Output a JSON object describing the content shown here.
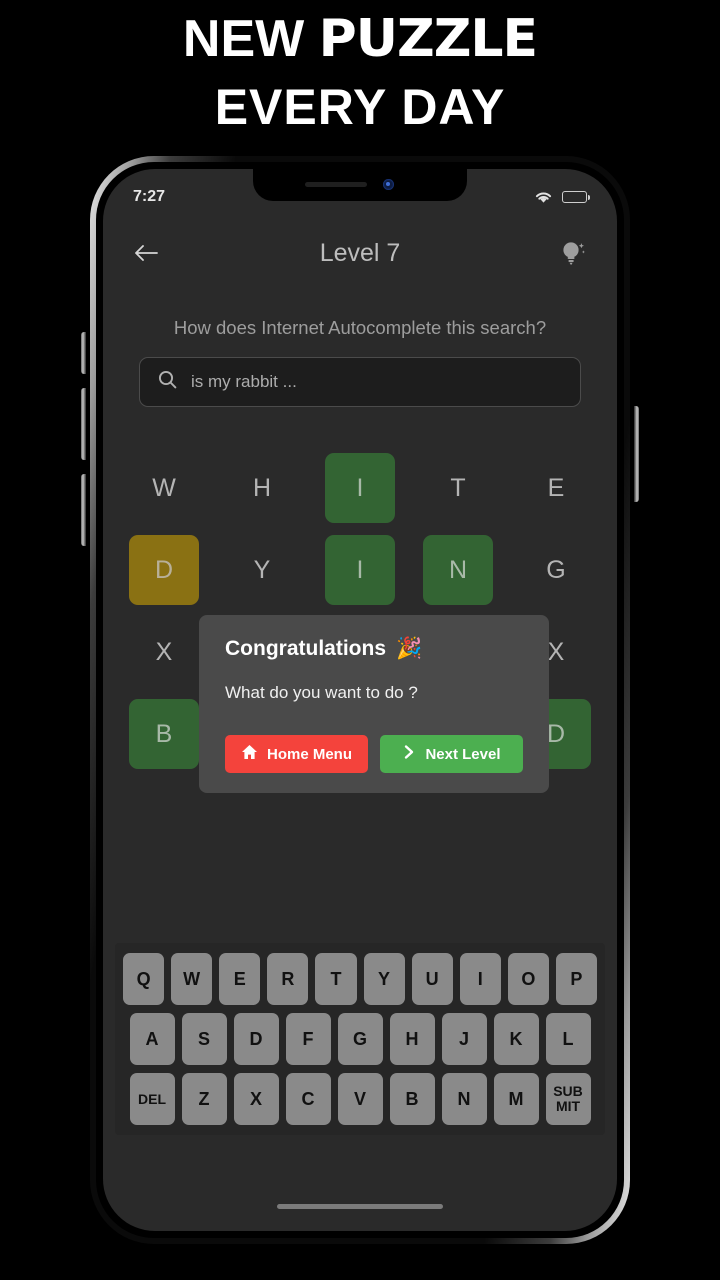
{
  "promo": {
    "line1_a": "NEW ",
    "line1_b": "PUZZLE",
    "line2": "EVERY DAY"
  },
  "status_bar": {
    "time": "7:27",
    "wifi_icon": "wifi-icon",
    "battery_icon": "battery-full-icon"
  },
  "app_header": {
    "back_icon": "back-arrow-icon",
    "title": "Level 7",
    "hint_icon": "lightbulb-hint-icon"
  },
  "puzzle": {
    "question": "How does Internet Autocomplete this search?",
    "search_icon": "search-icon",
    "search_value": "is my rabbit ...",
    "grid": [
      [
        {
          "letter": "W",
          "state": "empty"
        },
        {
          "letter": "H",
          "state": "empty"
        },
        {
          "letter": "I",
          "state": "green"
        },
        {
          "letter": "T",
          "state": "empty"
        },
        {
          "letter": "E",
          "state": "empty"
        }
      ],
      [
        {
          "letter": "D",
          "state": "yellow"
        },
        {
          "letter": "Y",
          "state": "empty"
        },
        {
          "letter": "I",
          "state": "green"
        },
        {
          "letter": "N",
          "state": "green"
        },
        {
          "letter": "G",
          "state": "empty"
        }
      ],
      [
        {
          "letter": "X",
          "state": "empty"
        },
        {
          "letter": "",
          "state": "empty"
        },
        {
          "letter": "",
          "state": "empty"
        },
        {
          "letter": "",
          "state": "empty"
        },
        {
          "letter": "X",
          "state": "empty"
        }
      ],
      [
        {
          "letter": "B",
          "state": "green"
        },
        {
          "letter": "",
          "state": "empty"
        },
        {
          "letter": "",
          "state": "empty"
        },
        {
          "letter": "",
          "state": "empty"
        },
        {
          "letter": "D",
          "state": "green"
        }
      ]
    ]
  },
  "dialog": {
    "title": "Congratulations",
    "title_emoji": "🎉",
    "subtitle": "What do you want to do ?",
    "home_button": {
      "label": "Home Menu",
      "icon": "home-icon",
      "color": "#f4433c"
    },
    "next_button": {
      "label": "Next Level",
      "icon": "chevron-right-icon",
      "color": "#4caf50"
    }
  },
  "keyboard": {
    "row1": [
      "Q",
      "W",
      "E",
      "R",
      "T",
      "Y",
      "U",
      "I",
      "O",
      "P"
    ],
    "row2": [
      "A",
      "S",
      "D",
      "F",
      "G",
      "H",
      "J",
      "K",
      "L"
    ],
    "row3": [
      "DEL",
      "Z",
      "X",
      "C",
      "V",
      "B",
      "N",
      "M"
    ],
    "submit_line1": "SUB",
    "submit_line2": "MIT"
  },
  "colors": {
    "green_tile": "#336433",
    "yellow_tile": "#8a7113",
    "dialog_bg": "#4a4a4a",
    "key_bg": "#8a8a8a",
    "screen_bg": "#2a2a2a"
  }
}
